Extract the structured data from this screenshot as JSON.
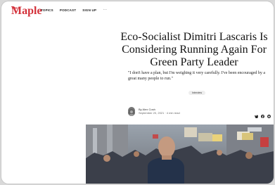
{
  "brand": {
    "logo_small": "The",
    "logo": "Maple"
  },
  "nav": {
    "links": [
      "TOPICS",
      "PODCAST",
      "SIGN UP"
    ],
    "more": "···"
  },
  "article": {
    "headline": "Eco-Socialist Dimitri Lascaris Is Considering Running Again For Green Party Leader",
    "dek": "\"I don't have a plan, but I'm weighing it very carefully. I've been encouraged by a great many people to run.\"",
    "tag": "Interview",
    "author": "By Alex Cosh",
    "date": "September 20, 2021 · 4 min read"
  },
  "share": {
    "icons": [
      "twitter-icon",
      "facebook-icon",
      "email-icon"
    ]
  },
  "colors": {
    "brand": "#d3313a"
  }
}
